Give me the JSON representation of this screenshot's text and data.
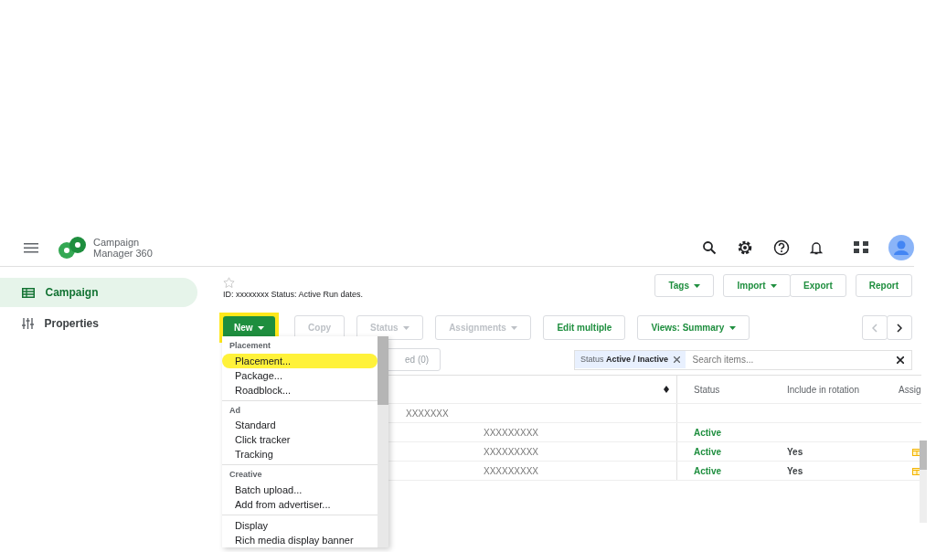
{
  "app": {
    "name_line_1": "Campaign",
    "name_line_2": "Manager 360"
  },
  "sidebar": {
    "items": [
      {
        "label": "Campaign",
        "selected": true
      },
      {
        "label": "Properties",
        "selected": false
      }
    ]
  },
  "campaign": {
    "info": "ID: xxxxxxxx  Status: Active  Run dates."
  },
  "top_buttons": [
    {
      "label": "Tags",
      "dropdown": true
    },
    {
      "label": "Import",
      "dropdown": true
    },
    {
      "label": "Export",
      "dropdown": false
    },
    {
      "label": "Report",
      "dropdown": false
    }
  ],
  "toolbar": [
    {
      "label": "New",
      "kind": "primary",
      "dropdown": true,
      "disabled": false,
      "highlighted": true
    },
    {
      "label": "Copy",
      "kind": "outline",
      "dropdown": false,
      "disabled": true,
      "highlighted": false
    },
    {
      "label": "Status",
      "kind": "outline",
      "dropdown": true,
      "disabled": true,
      "highlighted": false
    },
    {
      "label": "Assignments",
      "kind": "outline",
      "dropdown": true,
      "disabled": true,
      "highlighted": false
    },
    {
      "label": "Edit multiple",
      "kind": "outline",
      "dropdown": false,
      "disabled": false,
      "highlighted": false
    },
    {
      "label": "Views: Summary",
      "kind": "outline",
      "dropdown": true,
      "disabled": false,
      "highlighted": false
    }
  ],
  "filter_button": {
    "label": "ed (0)"
  },
  "filter": {
    "name": "Status",
    "value": "Active / Inactive"
  },
  "search": {
    "placeholder": "Search items..."
  },
  "table": {
    "columns": [
      "Status",
      "Include in rotation",
      "Assig"
    ],
    "rows": [
      {
        "kind": "group",
        "name": "XXXXXXX",
        "status": "",
        "rotation": "",
        "assigned": false
      },
      {
        "kind": "item",
        "name": "XXXXXXXXX",
        "status": "Active",
        "rotation": "",
        "assigned": false
      },
      {
        "kind": "item",
        "name": "XXXXXXXXX",
        "status": "Active",
        "rotation": "Yes",
        "assigned": true
      },
      {
        "kind": "item",
        "name": "XXXXXXXXX",
        "status": "Active",
        "rotation": "Yes",
        "assigned": true
      }
    ]
  },
  "new_menu": {
    "sections": [
      {
        "title": "Placement",
        "items": [
          {
            "label": "Placement...",
            "highlighted": true
          },
          {
            "label": "Package...",
            "highlighted": false
          },
          {
            "label": "Roadblock...",
            "highlighted": false
          }
        ]
      },
      {
        "title": "Ad",
        "items": [
          {
            "label": "Standard",
            "highlighted": false
          },
          {
            "label": "Click tracker",
            "highlighted": false
          },
          {
            "label": "Tracking",
            "highlighted": false
          }
        ]
      },
      {
        "title": "Creative",
        "items": [
          {
            "label": "Batch upload...",
            "highlighted": false
          },
          {
            "label": "Add from advertiser...",
            "highlighted": false
          }
        ]
      },
      {
        "items": [
          {
            "label": "Display",
            "highlighted": false
          },
          {
            "label": "Rich media display banner",
            "highlighted": false
          }
        ]
      }
    ]
  }
}
